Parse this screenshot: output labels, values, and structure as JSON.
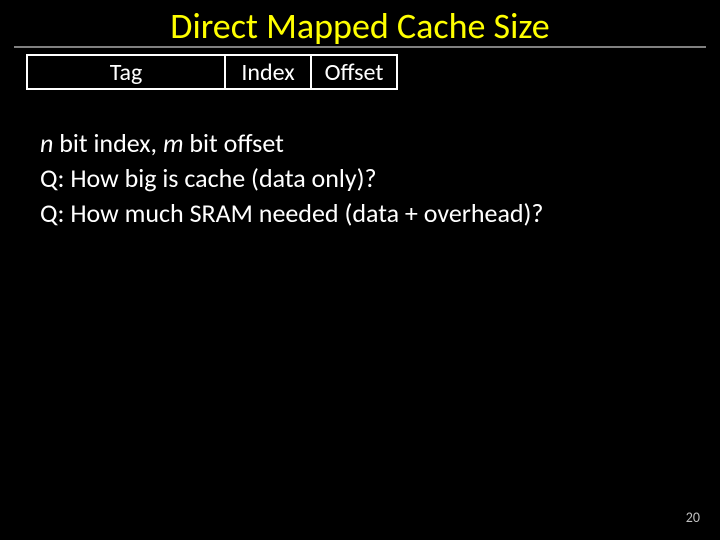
{
  "title": "Direct Mapped Cache Size",
  "address": {
    "tag": "Tag",
    "index": "Index",
    "offset": "Offset"
  },
  "lines": {
    "line1_prefix_italic": "n",
    "line1_mid": " bit index, ",
    "line1_mid_italic": "m",
    "line1_suffix": " bit offset",
    "line2": "Q: How big is cache (data only)?",
    "line3": "Q: How much SRAM needed (data + overhead)?"
  },
  "page_number": "20"
}
